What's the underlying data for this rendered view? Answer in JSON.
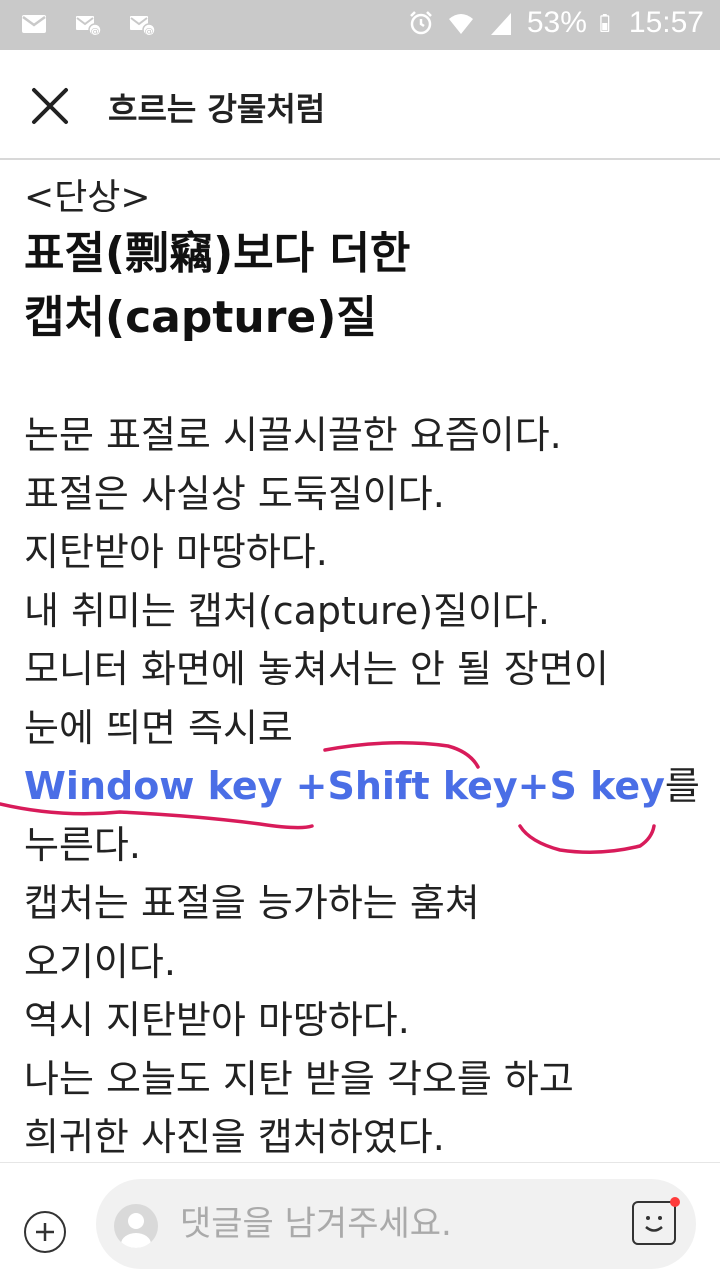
{
  "status_bar": {
    "battery": "53%",
    "time": "15:57",
    "icons": [
      "mail-icon",
      "email-at-icon",
      "email-at-icon",
      "alarm-icon",
      "wifi-icon",
      "signal-icon",
      "battery-icon"
    ]
  },
  "header": {
    "title": "흐르는 강물처럼"
  },
  "article": {
    "subtitle": "<단상>",
    "title_lines": [
      "표절(剽竊)보다 더한",
      "캡처(capture)질"
    ],
    "body": [
      "논문 표절로 시끌시끌한 요즘이다.",
      "표절은 사실상 도둑질이다.",
      "지탄받아 마땅하다.",
      "내 취미는 캡처(capture)질이다.",
      "모니터 화면에 놓쳐서는 안 될 장면이",
      "눈에 띄면 즉시로"
    ],
    "highlight_keys": "Window key +Shift key+S key",
    "highlight_suffix": "를",
    "body_after": [
      "누른다.",
      "캡처는 표절을 능가하는 훔쳐",
      "오기이다.",
      "역시 지탄받아 마땅하다.",
      "나는 오늘도 지탄 받을 각오를 하고",
      "희귀한 사진을 캡처하였다."
    ]
  },
  "comment_bar": {
    "placeholder": "댓글을 남겨주세요."
  },
  "colors": {
    "status_bar_bg": "#c9c9c9",
    "highlight_blue": "#4a6ee6",
    "annotation_red": "#d81b5a"
  }
}
